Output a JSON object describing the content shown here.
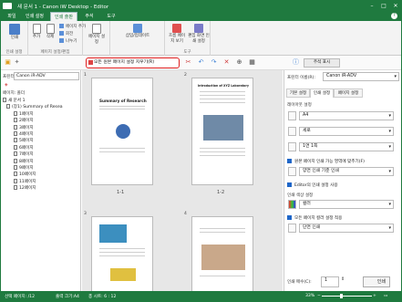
{
  "window": {
    "title": "새 문서 1 - Canon iW Desktop - Editor"
  },
  "tabs": [
    {
      "label": "파일"
    },
    {
      "label": "인쇄 설정"
    },
    {
      "label": "인쇄 출판"
    },
    {
      "label": "주석"
    },
    {
      "label": "도구"
    }
  ],
  "ribbon": {
    "print_label": "인쇄",
    "print_settings_label": "인쇄 설정",
    "add_label": "추가",
    "delete_label": "삭제",
    "add_page_label": "페이지 추가",
    "rotate_label": "회전",
    "split_label": "나누기",
    "page_settings_label": "페이지 설정",
    "group_label": "페이지 설정/편집",
    "insert_update_label": "삽입/업데이트",
    "tools_label": "도구",
    "continuous_label": "흐름 페이지 보기",
    "print_view_label": "편집 화면 인쇄 설정"
  },
  "toolbar": {
    "clear_button": "모든 원본 페이지 설정 지우기(R)",
    "annotation_button": "주석 표시"
  },
  "left": {
    "printer_label": "프린터:",
    "printer_value": "Canon iR-ADV",
    "pages_label": "페이지: 폴더",
    "tree": [
      {
        "label": "새 문서 1"
      },
      {
        "label": "(장1) Summary of Resea"
      },
      {
        "label": "1페이지"
      },
      {
        "label": "2페이지"
      },
      {
        "label": "3페이지"
      },
      {
        "label": "4페이지"
      },
      {
        "label": "5페이지"
      },
      {
        "label": "6페이지"
      },
      {
        "label": "7페이지"
      },
      {
        "label": "8페이지"
      },
      {
        "label": "9페이지"
      },
      {
        "label": "10페이지"
      },
      {
        "label": "11페이지"
      },
      {
        "label": "12페이지"
      }
    ]
  },
  "view": {
    "pages": [
      {
        "num": "1",
        "label": "1-1",
        "heading": "Summary of Research"
      },
      {
        "num": "2",
        "label": "1-2",
        "heading": "Introduction of XYZ Laboratory"
      },
      {
        "num": "3",
        "label": "",
        "heading": ""
      },
      {
        "num": "4",
        "label": "",
        "heading": ""
      }
    ]
  },
  "right": {
    "printer_label": "프린터 이름(R):",
    "printer_value": "Canon iR-ADV",
    "tabs": [
      "기본 설정",
      "인쇄 설정",
      "페이지 설정"
    ],
    "layout_label": "레이아웃 설정",
    "paper_size": "A4",
    "orientation": "세로",
    "pages_per_sheet": "1면 1쪽",
    "fit_label": "원본 페이지 인쇄 가능 영역에 맞추기(F)",
    "duplex": "양면 인쇄 기준 인쇄",
    "editor_label": "Editor의 인쇄 설정 사용",
    "color_label": "인쇄 색상 설정",
    "color_value": "컬러",
    "color_apply_label": "모든 페이지 컬러 설정 적용",
    "print_style": "단면 인쇄",
    "copies_label": "인쇄 매수(C):",
    "copies_value": "1",
    "print_button": "인쇄"
  },
  "status": {
    "selected": "선택 페이지: /12",
    "paper": "출력 크기:A4",
    "total": "총 시트: 6 : 12",
    "zoom": "33%"
  }
}
